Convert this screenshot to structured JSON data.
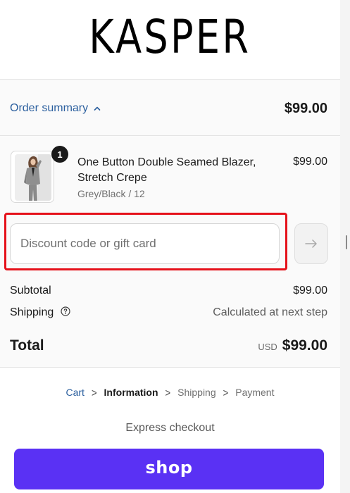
{
  "brand": {
    "logo_text": "KASPER"
  },
  "summary": {
    "toggle_label": "Order summary",
    "toggle_icon": "chevron-up-icon",
    "header_total": "$99.00"
  },
  "product": {
    "quantity": "1",
    "name": "One Button Double Seamed Blazer, Stretch Crepe",
    "variant": "Grey/Black / 12",
    "price": "$99.00"
  },
  "discount": {
    "placeholder": "Discount code or gift card",
    "value": "",
    "apply_icon": "arrow-right-icon"
  },
  "totals": {
    "subtotal_label": "Subtotal",
    "subtotal_value": "$99.00",
    "shipping_label": "Shipping",
    "shipping_value": "Calculated at next step",
    "total_label": "Total",
    "currency": "USD",
    "total_value": "$99.00"
  },
  "breadcrumbs": [
    {
      "label": "Cart",
      "state": "link"
    },
    {
      "label": "Information",
      "state": "current"
    },
    {
      "label": "Shipping",
      "state": "upcoming"
    },
    {
      "label": "Payment",
      "state": "upcoming"
    }
  ],
  "express": {
    "label": "Express checkout",
    "shop_pay_label": "shop"
  },
  "colors": {
    "link_blue": "#2b5f9e",
    "shop_pay_purple": "#5a31f4",
    "highlight_red": "#e5111a"
  }
}
